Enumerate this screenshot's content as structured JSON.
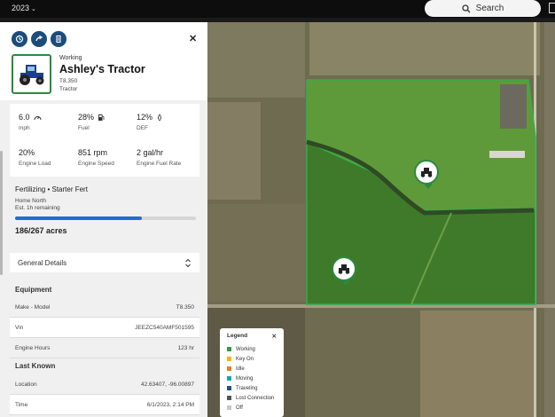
{
  "topbar": {
    "year": "2023",
    "search_label": "Search"
  },
  "vehicle": {
    "status": "Working",
    "name": "Ashley's Tractor",
    "model": "T8.350",
    "type": "Tractor"
  },
  "stats": [
    {
      "value": "6.0",
      "label": "mph",
      "icon": "speedometer-icon"
    },
    {
      "value": "28%",
      "label": "Fuel",
      "icon": "fuel-pump-icon"
    },
    {
      "value": "12%",
      "label": "DEF",
      "icon": "def-icon"
    },
    {
      "value": "20%",
      "label": "Engine Load"
    },
    {
      "value": "851 rpm",
      "label": "Engine Speed"
    },
    {
      "value": "2 gal/hr",
      "label": "Engine Fuel Rate"
    }
  ],
  "task": {
    "title": "Fertilizing • Starter Fert",
    "field": "Home North",
    "remaining": "Est. 1h remaining",
    "progress": 0.7,
    "acres": "186/267 acres"
  },
  "details_dropdown": "General Details",
  "equipment": {
    "heading": "Equipment",
    "rows": [
      {
        "label": "Make - Model",
        "value": "T8.350"
      },
      {
        "label": "Vin",
        "value": "JEEZC540AMF501595"
      },
      {
        "label": "Engine Hours",
        "value": "123 hr"
      }
    ]
  },
  "last_known": {
    "heading": "Last Known",
    "rows": [
      {
        "label": "Location",
        "value": "42.63407, -96.00897"
      },
      {
        "label": "Time",
        "value": "6/1/2023, 2:14 PM"
      }
    ]
  },
  "legend": {
    "title": "Legend",
    "items": [
      {
        "label": "Working",
        "color": "#2e9e44"
      },
      {
        "label": "Key On",
        "color": "#f2b416"
      },
      {
        "label": "Idle",
        "color": "#f07d1a"
      },
      {
        "label": "Moving",
        "color": "#18a6b5"
      },
      {
        "label": "Traveling",
        "color": "#1d4f91"
      },
      {
        "label": "Lost Connection",
        "color": "#555555"
      },
      {
        "label": "Off",
        "color": "#c8c8c8"
      }
    ]
  },
  "colors": {
    "accent": "#1b4c7a",
    "working": "#2b8a3e",
    "progress": "#1f6fd1"
  }
}
